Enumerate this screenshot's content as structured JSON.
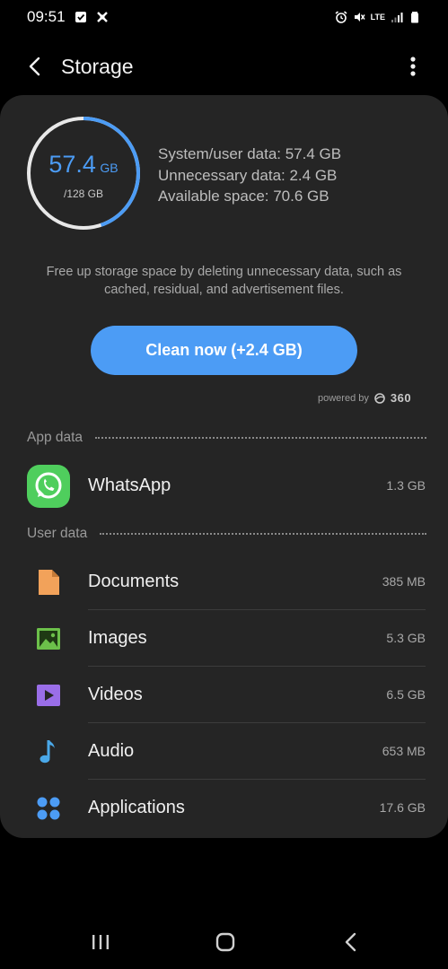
{
  "status_bar": {
    "time": "09:51",
    "network": "LTE"
  },
  "app_bar": {
    "title": "Storage"
  },
  "storage": {
    "used_value": "57.4",
    "used_unit": "GB",
    "total": "/128 GB",
    "used_fraction": 0.448,
    "system_user_data": "System/user data: 57.4 GB",
    "unnecessary_data": "Unnecessary data: 2.4 GB",
    "available_space": "Available space: 70.6 GB"
  },
  "cleanup": {
    "hint": "Free up storage space by deleting unnecessary data, such as cached, residual, and advertisement files.",
    "button_label": "Clean now (+2.4 GB)",
    "powered_by": "powered by",
    "brand": "360"
  },
  "app_data": {
    "label": "App data",
    "items": [
      {
        "name": "WhatsApp",
        "size": "1.3 GB",
        "icon": "whatsapp-icon"
      }
    ]
  },
  "user_data": {
    "label": "User data",
    "items": [
      {
        "name": "Documents",
        "size": "385 MB",
        "icon": "document-icon"
      },
      {
        "name": "Images",
        "size": "5.3 GB",
        "icon": "image-icon"
      },
      {
        "name": "Videos",
        "size": "6.5 GB",
        "icon": "video-icon"
      },
      {
        "name": "Audio",
        "size": "653 MB",
        "icon": "audio-icon"
      },
      {
        "name": "Applications",
        "size": "17.6 GB",
        "icon": "applications-icon"
      }
    ]
  },
  "colors": {
    "accent": "#4c9cf5",
    "card": "#252525",
    "background": "#000000",
    "documents": "#f2a25a",
    "images": "#6cc04a",
    "videos": "#9a6ee8",
    "audio": "#4aa8e8",
    "applications": "#4c9cf5",
    "whatsapp": "#4fce5d"
  }
}
